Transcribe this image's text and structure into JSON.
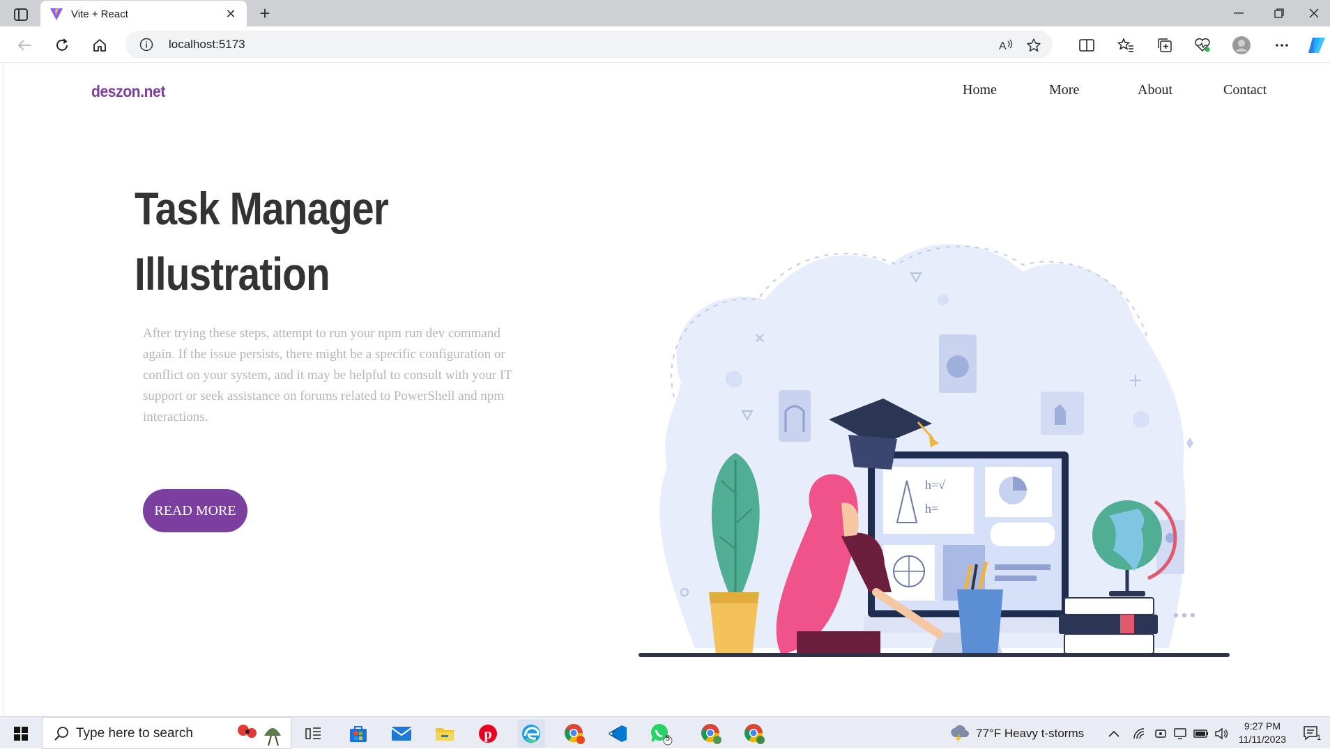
{
  "browser": {
    "tab_title": "Vite + React",
    "url": "localhost:5173"
  },
  "site": {
    "brand": "deszon.net",
    "nav": [
      "Home",
      "More",
      "About",
      "Contact"
    ],
    "hero": {
      "title_line1": "Task Manager",
      "title_line2": "Illustration",
      "text": "After trying these steps, attempt to run your npm run dev command again. If the issue persists, there might be a specific configuration or conflict on your system, and it may be helpful to consult with your IT support or seek assistance on forums related to PowerShell and npm interactions.",
      "button": "READ MORE"
    }
  },
  "taskbar": {
    "search_placeholder": "Type here to search",
    "weather": "77°F  Heavy t-storms",
    "time": "9:27 PM",
    "date": "11/11/2023",
    "whatsapp_badge": "5",
    "notification_count": "1"
  },
  "colors": {
    "brand": "#7b3fa0",
    "title": "#333333",
    "body_text": "#b5b5b5"
  }
}
